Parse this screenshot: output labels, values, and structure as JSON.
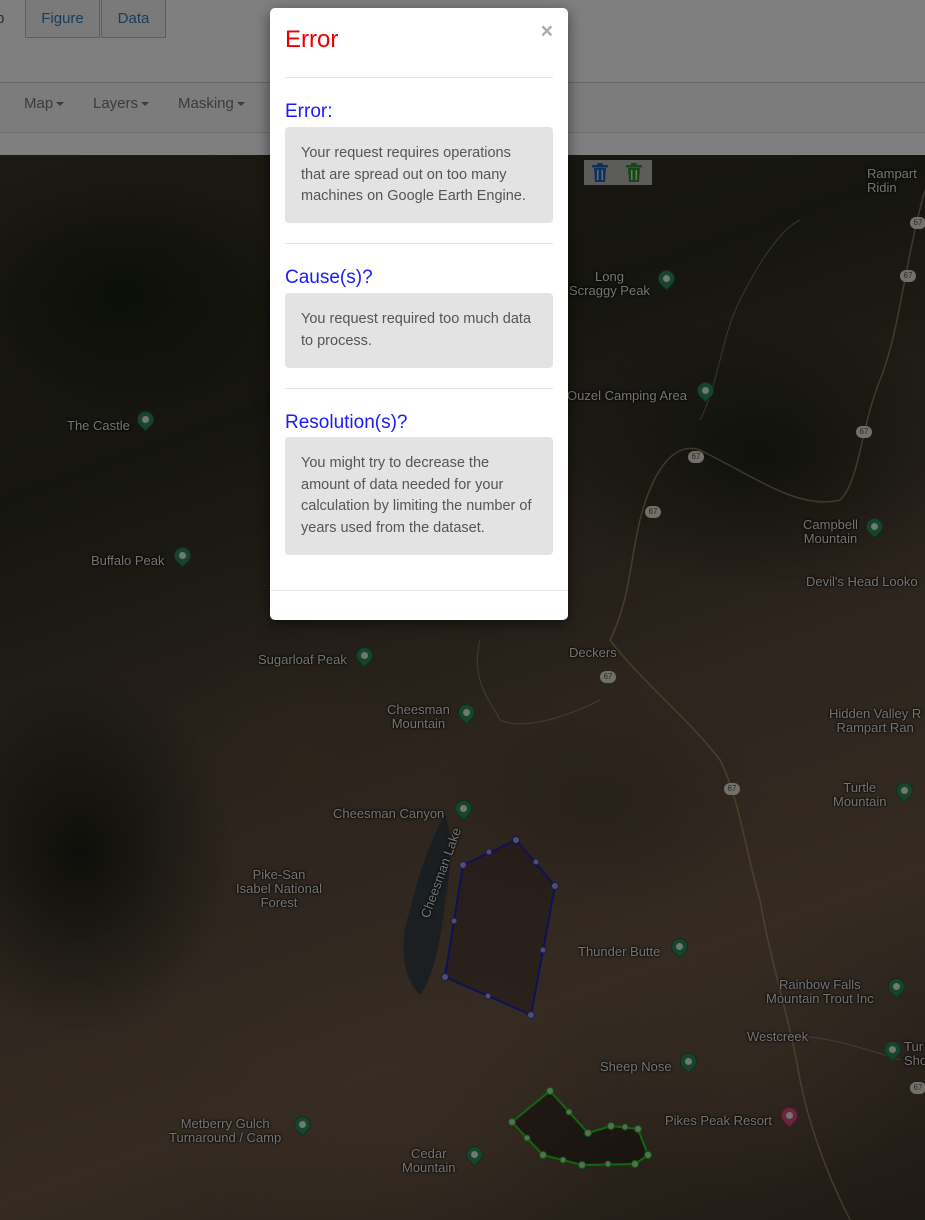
{
  "tabs": [
    {
      "label": "p"
    },
    {
      "label": "Figure"
    },
    {
      "label": "Data"
    }
  ],
  "menu": {
    "map": "Map",
    "layers": "Layers",
    "masking": "Masking"
  },
  "map_labels": {
    "rampart": "Rampart\nRidin",
    "long_scraggy": "Long\nScraggy Peak",
    "ouzel": "Ouzel Camping Area",
    "the_castle": "The Castle",
    "campbell": "Campbell\nMountain",
    "buffalo_peak": "Buffalo Peak",
    "devils_head": "Devil's Head Looko",
    "sugarloaf": "Sugarloaf Peak",
    "deckers": "Deckers",
    "cheesman_mtn": "Cheesman\nMountain",
    "hidden_valley": "Hidden Valley R\nRampart Ran",
    "turtle": "Turtle\nMountain",
    "cheesman_canyon": "Cheesman Canyon",
    "cheesman_lake": "Cheesman Lake",
    "pike_san_isabel": "Pike-San\nIsabel National\nForest",
    "thunder_butte": "Thunder Butte",
    "rainbow_falls": "Rainbow Falls\nMountain Trout Inc",
    "westcreek": "Westcreek",
    "tur_sho": "Tur\nSho",
    "sheep_nose": "Sheep Nose",
    "pikes_peak_resort": "Pikes Peak Resort",
    "metberry": "Metberry Gulch\nTurnaround / Camp",
    "cedar_mountain": "Cedar\nMountain"
  },
  "road_shields": [
    "67",
    "67",
    "67",
    "67",
    "67",
    "67",
    "67",
    "67"
  ],
  "icons": {
    "delete_blue": "trash-icon",
    "delete_green": "trash-icon"
  },
  "modal": {
    "title": "Error",
    "close": "×",
    "error_heading": "Error:",
    "error_text": "Your request requires operations that are spread out on too many machines on Google Earth Engine.",
    "cause_heading": "Cause(s)?",
    "cause_text": "You request required too much data to process.",
    "resolution_heading": "Resolution(s)?",
    "resolution_text": "You might try to decrease the amount of data needed for your calculation by limiting the number of years used from the dataset."
  },
  "colors": {
    "title_red": "#ee0000",
    "heading_blue": "#1a1aff",
    "polygon_blue": "#1a1aa0",
    "polygon_green": "#22cc22"
  }
}
